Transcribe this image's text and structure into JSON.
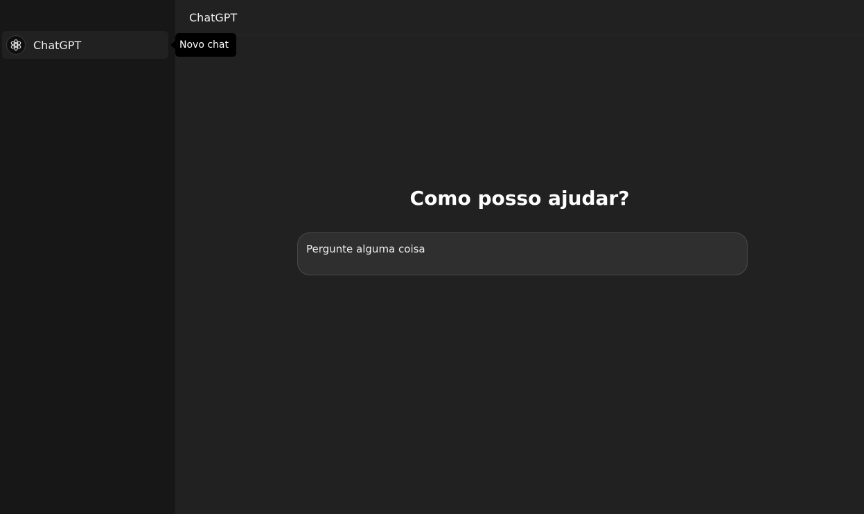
{
  "sidebar": {
    "items": [
      {
        "label": "ChatGPT",
        "icon": "openai-logo-icon"
      }
    ]
  },
  "tooltip": {
    "text": "Novo chat"
  },
  "header": {
    "title": "ChatGPT"
  },
  "main": {
    "heading": "Como posso ajudar?",
    "prompt": {
      "placeholder": "Pergunte alguma coisa",
      "value": ""
    }
  },
  "colors": {
    "sidebar_bg": "#171717",
    "main_bg": "#212121",
    "input_bg": "#2f2f2f",
    "tooltip_bg": "#000000"
  }
}
